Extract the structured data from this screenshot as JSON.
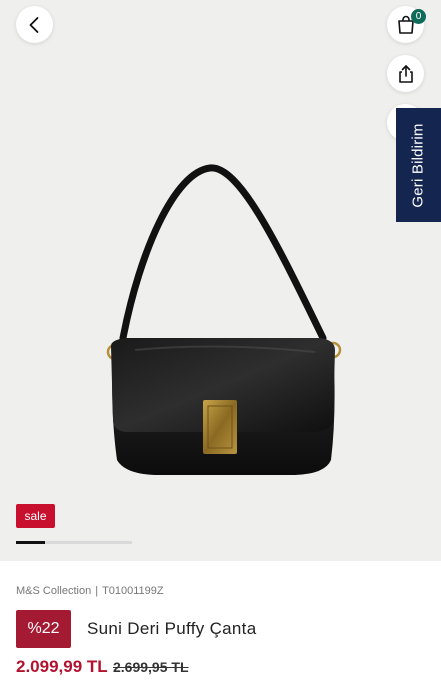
{
  "header": {
    "cart_count": "0",
    "feedback_label": "Geri Bildirim"
  },
  "icons": {
    "back": "chevron-left-icon",
    "cart": "shopping-bag-icon",
    "share": "share-icon"
  },
  "gallery": {
    "badge": "sale",
    "image": "black-shoulder-bag-product-photo",
    "progress": 0.25
  },
  "product": {
    "brand": "M&S Collection",
    "sku": "T01001199Z",
    "discount": "%22",
    "title": "Suni Deri Puffy Çanta",
    "price": "2.099,99 TL",
    "old_price": "2.699,95 TL"
  },
  "colors": {
    "discount_bg": "#a51a33",
    "sale_bg": "#c8102e",
    "price": "#b3122f",
    "feedback_bg": "#14264f",
    "cart_badge": "#0e6b5a"
  }
}
